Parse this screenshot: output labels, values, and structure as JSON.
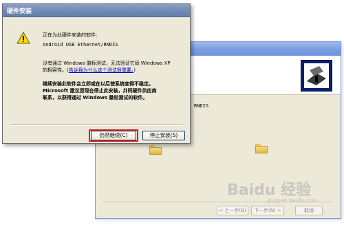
{
  "background_window": {
    "device_text_fragment": "RNDIS",
    "back_button": "< 上一步(B)",
    "next_button": "下一步(N) >",
    "cancel_button": "取消"
  },
  "dialog": {
    "title": "硬件安装",
    "line1": "正在为此硬件安装的软件:",
    "device_name": "Android USB Ethernet/RNDIS",
    "compat_line1": "没有通过 Windows 徽标测试，无法验证它同 Windows XP",
    "compat_line2_prefix": "的相容性。(",
    "compat_link": "告诉我为什么这个测试很重要。",
    "compat_line2_suffix": ")",
    "warning_line1": "继续安装此软件会立即或在以后使系统变得不稳定。",
    "warning_line2": "Microsoft 建议您现在停止此安装，并同硬件供应商",
    "warning_line3": "联系，以获得通过 Windows 徽标测试的软件。",
    "continue_button": "仍然继续(C)",
    "stop_button": "停止安装(S)"
  },
  "watermark": {
    "brand": "Baidu 经验",
    "sub": "jingyan.baidu.com"
  },
  "colors": {
    "dialog_bg": "#ece9d8",
    "highlight": "#d81e1e",
    "link": "#0000cc"
  }
}
